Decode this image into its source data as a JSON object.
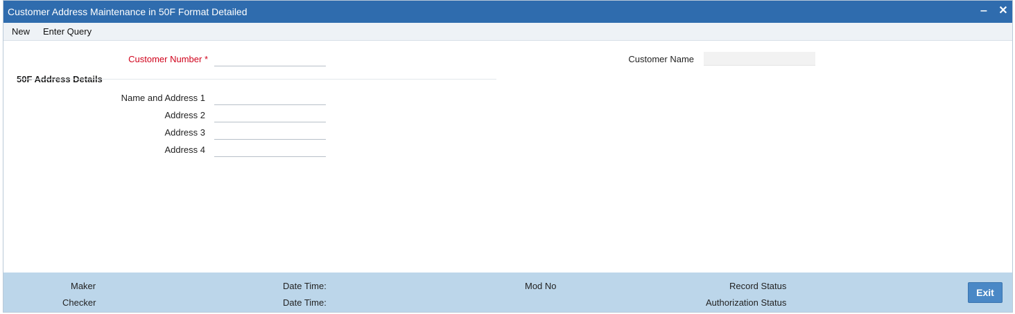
{
  "window": {
    "title": "Customer Address Maintenance in 50F Format Detailed",
    "minimize_glyph": "‒",
    "close_glyph": "✕"
  },
  "toolbar": {
    "new_label": "New",
    "enter_query_label": "Enter Query"
  },
  "form": {
    "customer_number_label": "Customer Number",
    "required_marker": "*",
    "customer_number_value": "",
    "customer_name_label": "Customer Name",
    "customer_name_value": "",
    "section_title": "50F Address Details",
    "name_address1_label": "Name and Address 1",
    "address2_label": "Address 2",
    "address3_label": "Address 3",
    "address4_label": "Address 4",
    "name_address1_value": "",
    "address2_value": "",
    "address3_value": "",
    "address4_value": ""
  },
  "footer": {
    "maker_label": "Maker",
    "checker_label": "Checker",
    "date_time_label_1": "Date Time:",
    "date_time_label_2": "Date Time:",
    "mod_no_label": "Mod No",
    "record_status_label": "Record Status",
    "authorization_status_label": "Authorization Status",
    "exit_label": "Exit"
  },
  "colors": {
    "titlebar": "#2f6cae",
    "footer": "#bcd6ea",
    "required": "#d0021b",
    "exit_button": "#4a88c6"
  },
  "icons": {
    "minimize": "minimize-icon",
    "close": "close-icon"
  }
}
